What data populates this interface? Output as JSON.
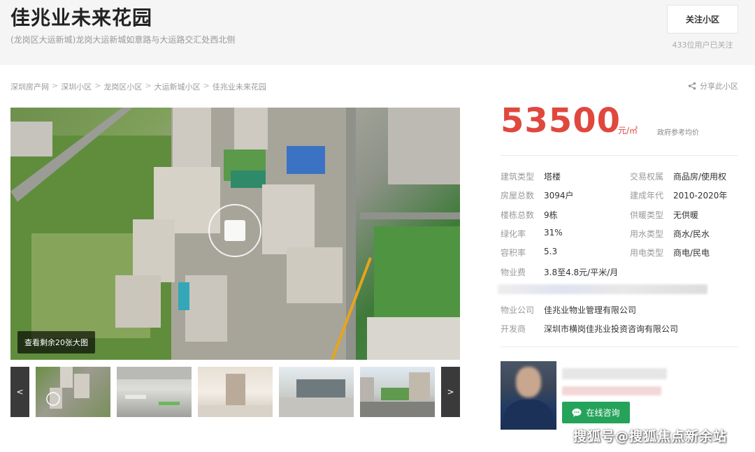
{
  "community": {
    "name": "佳兆业未来花园",
    "address": "(龙岗区大运新城)龙岗大运新城如意路与大运路交汇处西北侧",
    "follow_label": "关注小区",
    "follow_count": "433位用户已关注"
  },
  "breadcrumb": [
    "深圳房产网",
    "深圳小区",
    "龙岗区小区",
    "大运新城小区",
    "佳兆业未来花园"
  ],
  "breadcrumb_separator": ">",
  "share_label": "分享此小区",
  "gallery": {
    "view_more": "查看剩余20张大图",
    "prev": "<",
    "next": ">",
    "thumbnails": [
      {
        "name": "aerial"
      },
      {
        "name": "garage"
      },
      {
        "name": "lobby"
      },
      {
        "name": "entrance"
      },
      {
        "name": "street"
      }
    ]
  },
  "price": {
    "value": "53500",
    "unit": "元/㎡",
    "note": "政府参考均价"
  },
  "attributes_left": [
    {
      "label": "建筑类型",
      "value": "塔楼"
    },
    {
      "label": "房屋总数",
      "value": "3094户"
    },
    {
      "label": "楼栋总数",
      "value": "9栋"
    },
    {
      "label": "绿化率",
      "value": "31%"
    },
    {
      "label": "容积率",
      "value": "5.3"
    },
    {
      "label": "物业费",
      "value": "3.8至4.8元/平米/月"
    }
  ],
  "attributes_right": [
    {
      "label": "交易权属",
      "value": "商品房/使用权"
    },
    {
      "label": "建成年代",
      "value": "2010-2020年"
    },
    {
      "label": "供暖类型",
      "value": "无供暖"
    },
    {
      "label": "用水类型",
      "value": "商水/民水"
    },
    {
      "label": "用电类型",
      "value": "商电/民电"
    }
  ],
  "attributes_bottom": [
    {
      "label": "物业公司",
      "value": "佳兆业物业管理有限公司"
    },
    {
      "label": "开发商",
      "value": "深圳市横岗佳兆业投资咨询有限公司"
    }
  ],
  "agent": {
    "consult_label": "在线咨询"
  },
  "watermark": "搜狐号@搜狐焦点新余站",
  "colors": {
    "price": "#e0483e",
    "consult": "#25a35a",
    "header_bg": "#f5f5f5"
  },
  "icons": [
    "share-icon",
    "rotate-360-icon",
    "chat-bubble-icon"
  ]
}
